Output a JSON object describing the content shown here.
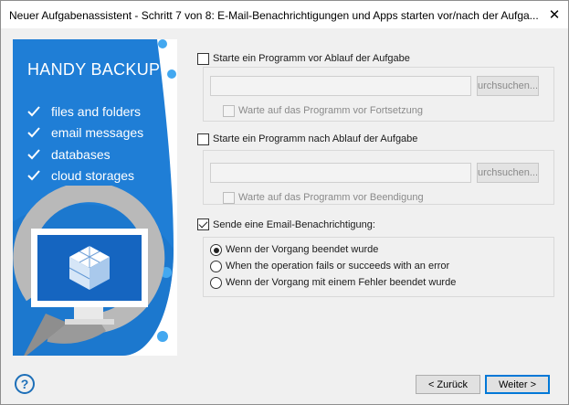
{
  "window": {
    "title": "Neuer Aufgabenassistent - Schritt 7 von 8: E-Mail-Benachrichtigungen und Apps starten vor/nach der Aufga...",
    "close_glyph": "✕"
  },
  "banner": {
    "brand": "HANDY BACKUP",
    "features": [
      "files and folders",
      "email messages",
      "databases",
      "cloud storages"
    ],
    "colors": {
      "primary": "#1f7ed6",
      "dark": "#1565b8",
      "light_dot": "#43a8f0"
    }
  },
  "pre_task": {
    "checkbox_label": "Starte ein Programm vor Ablauf der Aufgabe",
    "checked": false,
    "path_value": "",
    "browse_label": "urchsuchen...",
    "wait_label": "Warte auf das Programm vor Fortsetzung",
    "wait_checked": false
  },
  "post_task": {
    "checkbox_label": "Starte ein Programm nach Ablauf der Aufgabe",
    "checked": false,
    "path_value": "",
    "browse_label": "urchsuchen...",
    "wait_label": "Warte auf das Programm vor Beendigung",
    "wait_checked": false
  },
  "email": {
    "checkbox_label": "Sende eine Email-Benachrichtigung:",
    "checked": true,
    "options": [
      {
        "label": "Wenn der Vorgang beendet wurde",
        "selected": true
      },
      {
        "label": "When the operation fails or succeeds with an error",
        "selected": false
      },
      {
        "label": "Wenn der Vorgang mit einem Fehler beendet wurde",
        "selected": false
      }
    ]
  },
  "footer": {
    "help_glyph": "?",
    "back_label": "< Zurück",
    "next_label": "Weiter >"
  }
}
